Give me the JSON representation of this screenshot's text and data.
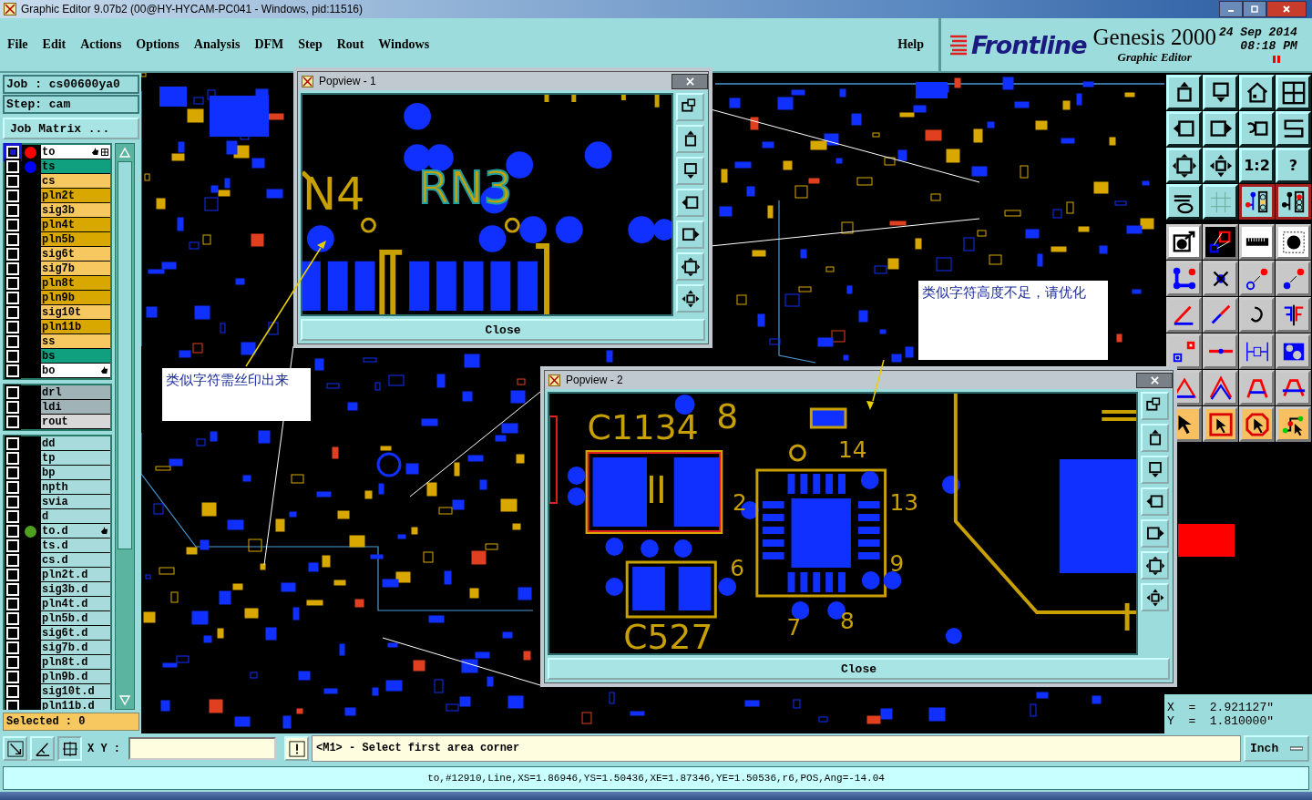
{
  "window": {
    "title": "Graphic Editor 9.07b2 (00@HY-HYCAM-PC041 - Windows, pid:11516)"
  },
  "menu": [
    {
      "label": "File"
    },
    {
      "label": "Edit"
    },
    {
      "label": "Actions"
    },
    {
      "label": "Options"
    },
    {
      "label": "Analysis"
    },
    {
      "label": "DFM"
    },
    {
      "label": "Step"
    },
    {
      "label": "Rout"
    },
    {
      "label": "Windows"
    }
  ],
  "help": "Help",
  "brand": {
    "logo": "Frontline",
    "product": "Genesis 2000",
    "subtitle": "Graphic Editor",
    "date": "24 Sep 2014",
    "time": "08:18 PM"
  },
  "job": {
    "job": "Job : cs00600ya0",
    "step": "Step: cam",
    "matrix_button": "Job Matrix ..."
  },
  "layer_groups": [
    {
      "layers": [
        {
          "name": "to",
          "kind": "outer",
          "color": "#ff0000",
          "hand": true,
          "active": true
        },
        {
          "name": "ts",
          "kind": "mask",
          "color": "#0000ff",
          "hand": false,
          "active": false
        },
        {
          "name": "cs",
          "kind": "signal",
          "hand": false,
          "active": false
        },
        {
          "name": "pln2t",
          "kind": "plane",
          "hand": false,
          "active": false
        },
        {
          "name": "sig3b",
          "kind": "signal",
          "hand": false,
          "active": false
        },
        {
          "name": "pln4t",
          "kind": "plane",
          "hand": false,
          "active": false
        },
        {
          "name": "pln5b",
          "kind": "plane",
          "hand": false,
          "active": false
        },
        {
          "name": "sig6t",
          "kind": "signal",
          "hand": false,
          "active": false
        },
        {
          "name": "sig7b",
          "kind": "signal",
          "hand": false,
          "active": false
        },
        {
          "name": "pln8t",
          "kind": "plane",
          "hand": false,
          "active": false
        },
        {
          "name": "pln9b",
          "kind": "plane",
          "hand": false,
          "active": false
        },
        {
          "name": "sig10t",
          "kind": "signal",
          "hand": false,
          "active": false
        },
        {
          "name": "pln11b",
          "kind": "plane",
          "hand": false,
          "active": false
        },
        {
          "name": "ss",
          "kind": "signal",
          "hand": false,
          "active": false
        },
        {
          "name": "bs",
          "kind": "mask",
          "hand": false,
          "active": false
        },
        {
          "name": "bo",
          "kind": "outer",
          "hand": true,
          "active": false
        }
      ]
    },
    {
      "layers": [
        {
          "name": "drl",
          "kind": "drill",
          "hand": false,
          "active": false
        },
        {
          "name": "ldi",
          "kind": "drill",
          "hand": false,
          "active": false
        },
        {
          "name": "rout",
          "kind": "rout",
          "hand": false,
          "active": false
        }
      ]
    },
    {
      "layers": [
        {
          "name": "dd",
          "kind": "other",
          "hand": false,
          "active": false
        },
        {
          "name": "tp",
          "kind": "other",
          "hand": false,
          "active": false
        },
        {
          "name": "bp",
          "kind": "other",
          "hand": false,
          "active": false
        },
        {
          "name": "npth",
          "kind": "other",
          "hand": false,
          "active": false
        },
        {
          "name": "svia",
          "kind": "other",
          "hand": false,
          "active": false
        },
        {
          "name": "d",
          "kind": "other",
          "hand": false,
          "active": false
        },
        {
          "name": "to.d",
          "kind": "other",
          "color": "#50a020",
          "hand": true,
          "active": false
        },
        {
          "name": "ts.d",
          "kind": "other",
          "hand": false,
          "active": false
        },
        {
          "name": "cs.d",
          "kind": "other",
          "hand": false,
          "active": false
        },
        {
          "name": "pln2t.d",
          "kind": "other",
          "hand": false,
          "active": false
        },
        {
          "name": "sig3b.d",
          "kind": "other",
          "hand": false,
          "active": false
        },
        {
          "name": "pln4t.d",
          "kind": "other",
          "hand": false,
          "active": false
        },
        {
          "name": "pln5b.d",
          "kind": "other",
          "hand": false,
          "active": false
        },
        {
          "name": "sig6t.d",
          "kind": "other",
          "hand": false,
          "active": false
        },
        {
          "name": "sig7b.d",
          "kind": "other",
          "hand": false,
          "active": false
        },
        {
          "name": "pln8t.d",
          "kind": "other",
          "hand": false,
          "active": false
        },
        {
          "name": "pln9b.d",
          "kind": "other",
          "hand": false,
          "active": false
        },
        {
          "name": "sig10t.d",
          "kind": "other",
          "hand": false,
          "active": false
        },
        {
          "name": "pln11b.d",
          "kind": "other",
          "hand": false,
          "active": false
        }
      ]
    }
  ],
  "selected_count": "Selected : 0",
  "toolbar": {
    "scale": "1:2",
    "query": "?"
  },
  "popviews": [
    {
      "title": "Popview - 1",
      "close": "Close",
      "labels": [
        "N4",
        "RN3"
      ]
    },
    {
      "title": "Popview - 2",
      "close": "Close",
      "labels": [
        "C1134",
        "8",
        "2",
        "6",
        "13",
        "9",
        "14",
        "7",
        "8",
        "C527"
      ]
    }
  ],
  "notes": [
    "类似字符需丝印出来",
    "类似字符高度不足，请优化"
  ],
  "coords": {
    "x": "X  =  2.921127\"",
    "y": "Y  =  1.810000\""
  },
  "command": {
    "xy_label": "X Y :",
    "prompt": "<M1> - Select first area corner",
    "units": "Inch"
  },
  "status": "to,#12910,Line,XS=1.86946,YS=1.50436,XE=1.87346,YE=1.50536,r6,POS,Ang=-14.04"
}
